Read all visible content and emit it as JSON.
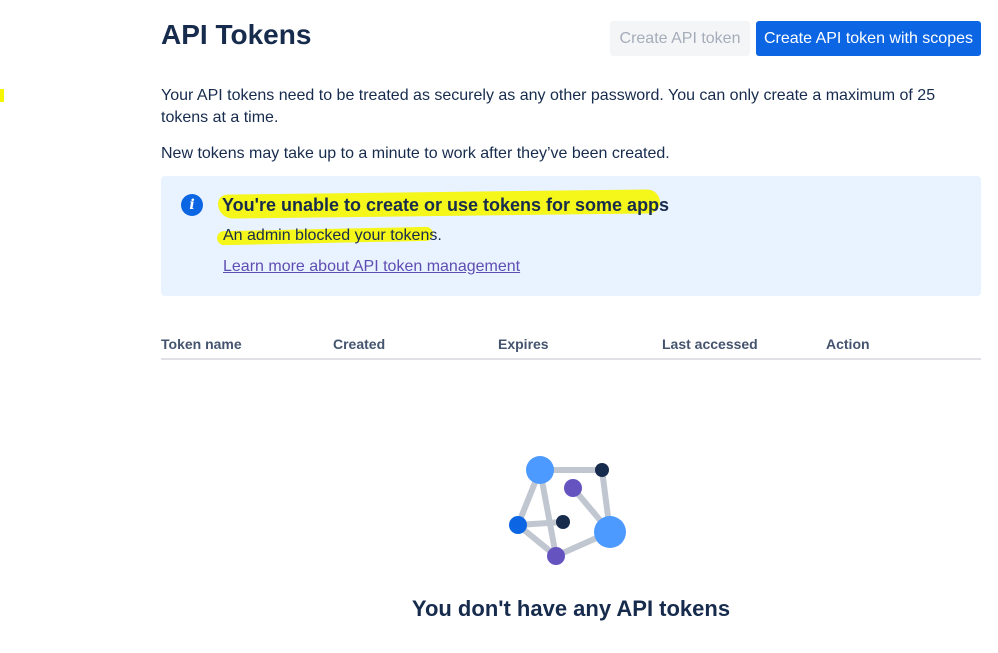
{
  "header": {
    "title": "API Tokens",
    "create_token_label": "Create API token",
    "create_scoped_token_label": "Create API token with scopes"
  },
  "intro": {
    "description": "Your API tokens need to be treated as securely as any other password. You can only create a maximum of 25 tokens at a time.",
    "note": "New tokens may take up to a minute to work after they’ve been created."
  },
  "info_panel": {
    "icon": "info-icon",
    "heading": "You're unable to create or use tokens for some apps",
    "message": "An admin blocked your tokens.",
    "link": "Learn more about API token management"
  },
  "table": {
    "columns": [
      "Token name",
      "Created",
      "Expires",
      "Last accessed",
      "Action"
    ]
  },
  "empty_state": {
    "title": "You don't have any API tokens"
  },
  "colors": {
    "primary": "#0c66e4",
    "text": "#172b4d",
    "info_background": "#e9f2ff",
    "highlight": "#f6f600",
    "link": "#5e4db2"
  }
}
